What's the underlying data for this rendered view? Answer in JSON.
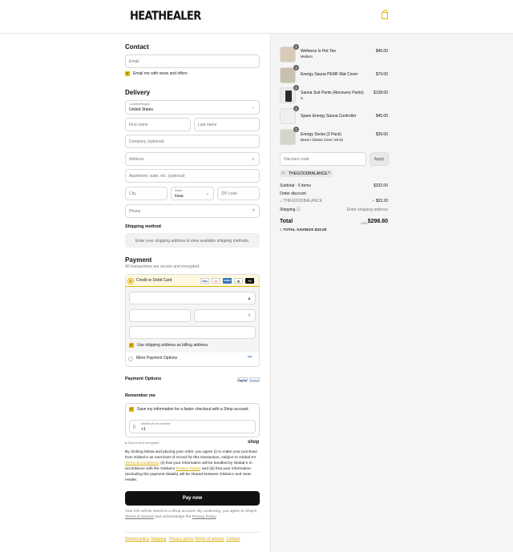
{
  "brand": {
    "logo": "HEATHEALER"
  },
  "contact": {
    "title": "Contact",
    "email_placeholder": "Email",
    "news_label": "Email me with news and offers"
  },
  "delivery": {
    "title": "Delivery",
    "country_label": "Country/Region",
    "country_value": "United States",
    "first_name": "First name",
    "last_name": "Last name",
    "company": "Company (optional)",
    "address": "Address",
    "apartment": "Apartment, suite, etc. (optional)",
    "city": "City",
    "state_label": "State",
    "state_value": "Iowa",
    "zip": "ZIP code",
    "phone": "Phone"
  },
  "shipping": {
    "title": "Shipping method",
    "message": "Enter your shipping address to view available shipping methods."
  },
  "payment": {
    "title": "Payment",
    "subtitle": "All transactions are secure and encrypted.",
    "credit_label": "Credit or Debit Card",
    "cards": [
      "VISA",
      "MC",
      "AMEX",
      "DISC",
      "+2"
    ],
    "billing_label": "Use shipping address as billing address",
    "more_label": "More Payment Options",
    "more_icon": "•••"
  },
  "payment_options": {
    "title": "Payment Options",
    "badges": [
      "PayPal",
      "Venmo"
    ]
  },
  "remember": {
    "title": "Remember me",
    "save_label": "Save my information for a faster checkout with a Shop account",
    "mobile_label": "Mobile phone number",
    "mobile_value": "+1",
    "secure_text": "Secure and encrypted",
    "shop": "shop"
  },
  "legal": {
    "p1": "By clicking below and placing your order, you agree (i) to make your purchase from Global-e as merchant of record for this transaction, subject to Global-e's ",
    "terms_link": "Terms & Conditions",
    "p2": "; (ii) that your information will be handled by Global-e in accordance with the Global-e ",
    "privacy_link": "Privacy Policy",
    "p3": "; and (iii) that your information (excluding the payment details) will be shared between Global-e and Heat Healer."
  },
  "pay_button": "Pay now",
  "shop_notice": {
    "p1": "Your info will be saved to a Shop account. By continuing, you agree to Shop's ",
    "tos": "Terms of Service",
    "p2": " and acknowledge the ",
    "privacy": "Privacy Policy",
    "p3": "."
  },
  "footer": [
    "Refund policy",
    "Shipping",
    "Privacy policy",
    "Terms of service",
    "Contact"
  ],
  "cart": {
    "items": [
      {
        "qty": "1",
        "name": "Wellness Is Hot Tee",
        "variant": "Medium",
        "price": "$46.00"
      },
      {
        "qty": "1",
        "name": "Energy Sauna PEMF Mat Cover",
        "variant": "",
        "price": "$79.00"
      },
      {
        "qty": "1",
        "name": "Sauna Suit Pants (Recovery Pants)",
        "variant": "S",
        "price": "$128.00"
      },
      {
        "qty": "1",
        "name": "Spare Energy Sauna Controller",
        "variant": "",
        "price": "$40.00"
      },
      {
        "qty": "1",
        "name": "Energy Socks (2 Pack)",
        "variant": "Beets / Classic Crew / 28-32",
        "price": "$39.00"
      }
    ],
    "discount_placeholder": "Discount code",
    "apply": "Apply",
    "code_tag": "THEGOODBALANCE",
    "subtotal_label": "Subtotal · 5 items",
    "subtotal": "$332.00",
    "order_discount_label": "Order discount",
    "discount_code": "THEGOODBALANCE",
    "discount_value": "− $33.20",
    "shipping_label": "Shipping",
    "shipping_value": "Enter shipping address",
    "total_label": "Total",
    "currency": "USD",
    "total": "$298.80",
    "savings_label": "TOTAL SAVINGS",
    "savings": "$33.20"
  },
  "colors": {
    "accent": "#e0b400",
    "button": "#111111",
    "panel": "#f5f5f5"
  }
}
